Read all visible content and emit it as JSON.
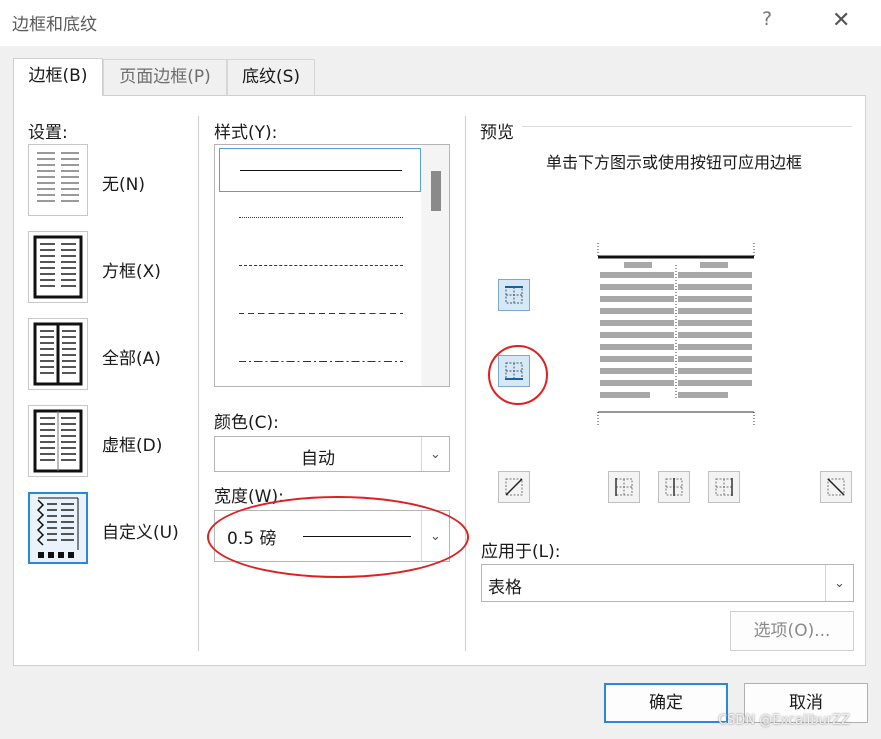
{
  "window": {
    "title": "边框和底纹",
    "help": "?",
    "close": "✕"
  },
  "tabs": [
    {
      "label": "边框(B)"
    },
    {
      "label": "页面边框(P)"
    },
    {
      "label": "底纹(S)"
    }
  ],
  "settings": {
    "label": "设置:",
    "items": [
      {
        "label": "无(N)"
      },
      {
        "label": "方框(X)"
      },
      {
        "label": "全部(A)"
      },
      {
        "label": "虚框(D)"
      },
      {
        "label": "自定义(U)"
      }
    ]
  },
  "style": {
    "label": "样式(Y):"
  },
  "color": {
    "label": "颜色(C):",
    "value": "自动"
  },
  "width": {
    "label": "宽度(W):",
    "value": "0.5 磅"
  },
  "preview": {
    "label": "预览",
    "hint": "单击下方图示或使用按钮可应用边框"
  },
  "apply_to": {
    "label": "应用于(L):",
    "value": "表格"
  },
  "buttons": {
    "options": "选项(O)...",
    "ok": "确定",
    "cancel": "取消"
  },
  "watermark": "CSDN @ExcaliburZZ",
  "colors": {
    "accent": "#2b88d8",
    "annotation": "#e02020"
  }
}
